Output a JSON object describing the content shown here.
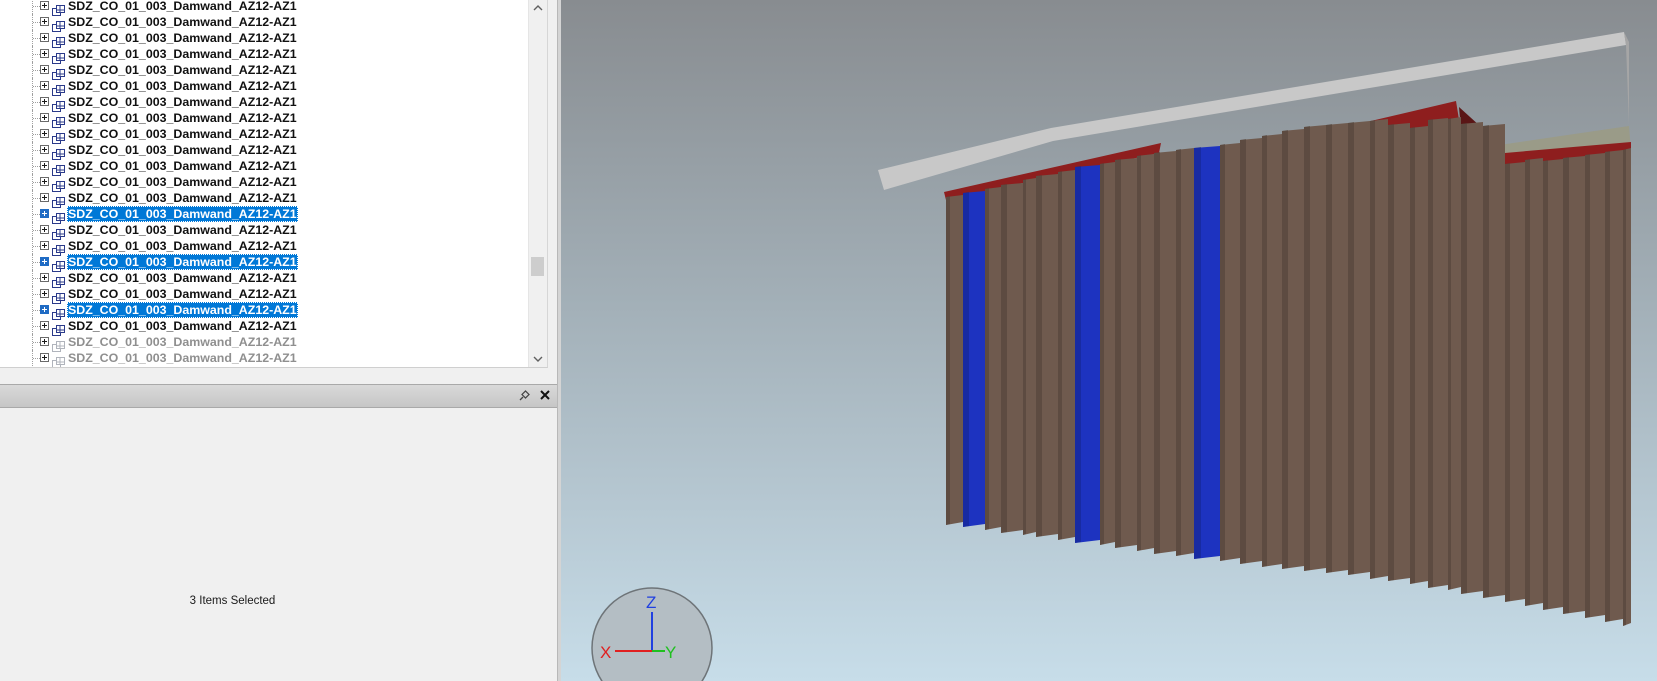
{
  "tree": {
    "items": [
      {
        "label": "SDZ_CO_01_003_Damwand_AZ12-AZ1",
        "selected": false,
        "dim": false
      },
      {
        "label": "SDZ_CO_01_003_Damwand_AZ12-AZ1",
        "selected": false,
        "dim": false
      },
      {
        "label": "SDZ_CO_01_003_Damwand_AZ12-AZ1",
        "selected": false,
        "dim": false
      },
      {
        "label": "SDZ_CO_01_003_Damwand_AZ12-AZ1",
        "selected": false,
        "dim": false
      },
      {
        "label": "SDZ_CO_01_003_Damwand_AZ12-AZ1",
        "selected": false,
        "dim": false
      },
      {
        "label": "SDZ_CO_01_003_Damwand_AZ12-AZ1",
        "selected": false,
        "dim": false
      },
      {
        "label": "SDZ_CO_01_003_Damwand_AZ12-AZ1",
        "selected": false,
        "dim": false
      },
      {
        "label": "SDZ_CO_01_003_Damwand_AZ12-AZ1",
        "selected": false,
        "dim": false
      },
      {
        "label": "SDZ_CO_01_003_Damwand_AZ12-AZ1",
        "selected": false,
        "dim": false
      },
      {
        "label": "SDZ_CO_01_003_Damwand_AZ12-AZ1",
        "selected": false,
        "dim": false
      },
      {
        "label": "SDZ_CO_01_003_Damwand_AZ12-AZ1",
        "selected": false,
        "dim": false
      },
      {
        "label": "SDZ_CO_01_003_Damwand_AZ12-AZ1",
        "selected": false,
        "dim": false
      },
      {
        "label": "SDZ_CO_01_003_Damwand_AZ12-AZ1",
        "selected": false,
        "dim": false
      },
      {
        "label": "SDZ_CO_01_003_Damwand_AZ12-AZ1",
        "selected": true,
        "dim": false
      },
      {
        "label": "SDZ_CO_01_003_Damwand_AZ12-AZ1",
        "selected": false,
        "dim": false
      },
      {
        "label": "SDZ_CO_01_003_Damwand_AZ12-AZ1",
        "selected": false,
        "dim": false
      },
      {
        "label": "SDZ_CO_01_003_Damwand_AZ12-AZ1",
        "selected": true,
        "dim": false
      },
      {
        "label": "SDZ_CO_01_003_Damwand_AZ12-AZ1",
        "selected": false,
        "dim": false
      },
      {
        "label": "SDZ_CO_01_003_Damwand_AZ12-AZ1",
        "selected": false,
        "dim": false
      },
      {
        "label": "SDZ_CO_01_003_Damwand_AZ12-AZ1",
        "selected": true,
        "dim": false
      },
      {
        "label": "SDZ_CO_01_003_Damwand_AZ12-AZ1",
        "selected": false,
        "dim": false
      },
      {
        "label": "SDZ_CO_01_003_Damwand_AZ12-AZ1",
        "selected": false,
        "dim": true
      },
      {
        "label": "SDZ_CO_01_003_Damwand_AZ12-AZ1",
        "selected": false,
        "dim": true
      }
    ]
  },
  "properties_panel": {
    "status_text": "3 Items Selected",
    "icons": {
      "pin": "pin-icon",
      "close": "close-icon"
    }
  },
  "viewport": {
    "axis_gizmo": {
      "x_label": "X",
      "y_label": "Y",
      "z_label": "Z"
    },
    "colors": {
      "background_top": "#888c90",
      "background_bottom": "#c7dde9",
      "pile": "#6f5a4e",
      "pile_selected": "#1d33c0",
      "waler_beam": "#8e1e1e",
      "slab": "#c9c9c9",
      "axis_x": "#e02020",
      "axis_y": "#20c020",
      "axis_z": "#2040e0"
    }
  },
  "colors": {
    "selection": "#0078d7",
    "panel_bg": "#f0f0f0"
  }
}
